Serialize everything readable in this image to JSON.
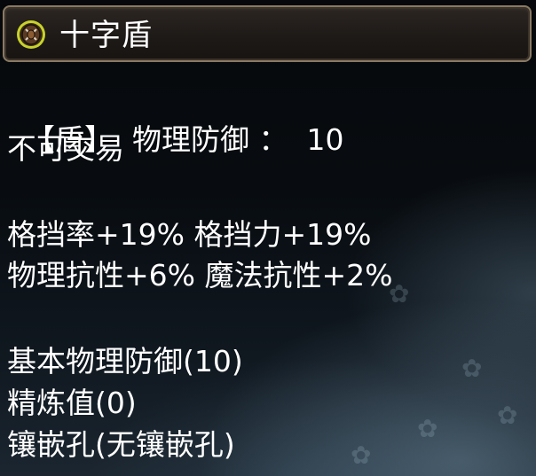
{
  "item": {
    "name": "十字盾",
    "icon": "shield-icon",
    "type_label": "【盾】",
    "defense_label": "物理防御",
    "defense_separator": "：",
    "defense_value": "10",
    "trade": "不可交易"
  },
  "bonuses": {
    "line1": "格挡率+19% 格挡力+19%",
    "line2": "物理抗性+6% 魔法抗性+2%"
  },
  "details": {
    "base_defense": "基本物理防御(10)",
    "refine": "精炼值(0)",
    "sockets": "镶嵌孔(无镶嵌孔)"
  },
  "colors": {
    "text": "#ffffff",
    "frame": "#8a7a63",
    "icon_ring": "#c8d22a"
  }
}
